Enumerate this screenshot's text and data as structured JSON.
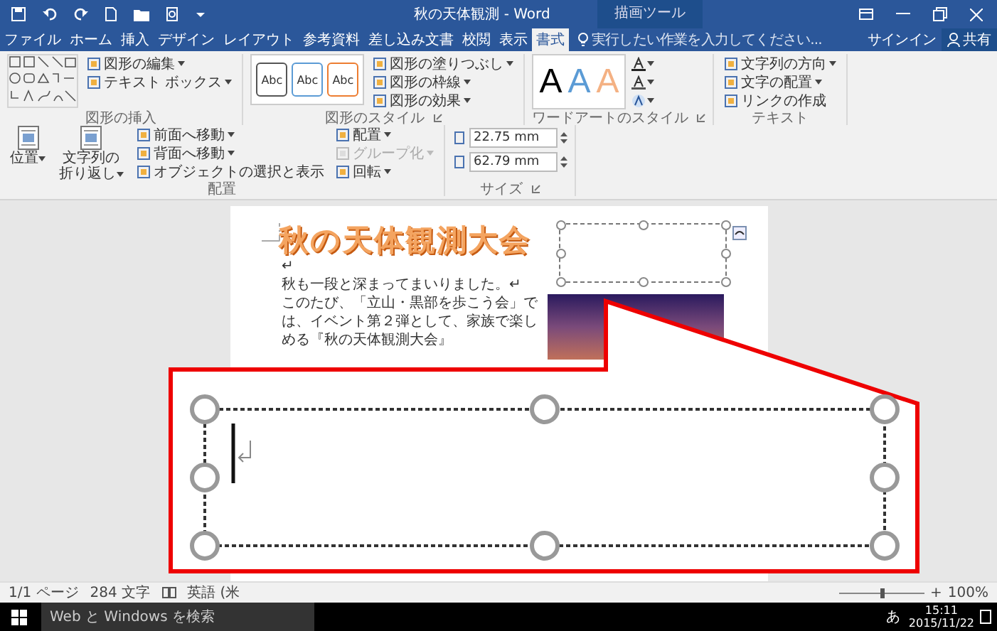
{
  "title_bar": {
    "title": "秋の天体観測 - Word",
    "context_tab": "描画ツール"
  },
  "tabs": [
    {
      "label": "ファイル",
      "selected": false
    },
    {
      "label": "ホーム",
      "selected": false
    },
    {
      "label": "挿入",
      "selected": false
    },
    {
      "label": "デザイン",
      "selected": false
    },
    {
      "label": "レイアウト",
      "selected": false
    },
    {
      "label": "参考資料",
      "selected": false
    },
    {
      "label": "差し込み文書",
      "selected": false
    },
    {
      "label": "校閲",
      "selected": false
    },
    {
      "label": "表示",
      "selected": false
    },
    {
      "label": "書式",
      "selected": true
    }
  ],
  "tell_me": {
    "placeholder": "実行したい作業を入力してください..."
  },
  "account": {
    "sign_in": "サインイン",
    "share": "共有"
  },
  "ribbon": {
    "groups": [
      {
        "label": "図形の挿入",
        "launcher": false,
        "items": [
          {
            "kind": "shapes"
          },
          {
            "kind": "stack",
            "buttons": [
              {
                "label": "図形の編集",
                "dropdown": true,
                "disabled": false
              },
              {
                "label": "テキスト ボックス",
                "dropdown": true,
                "disabled": false
              }
            ]
          }
        ]
      },
      {
        "label": "図形のスタイル",
        "launcher": true,
        "items": [
          {
            "kind": "styles",
            "swatches": [
              {
                "label": "Abc",
                "color": "#555555"
              },
              {
                "label": "Abc",
                "color": "#5b9bd5"
              },
              {
                "label": "Abc",
                "color": "#ed7d31"
              }
            ]
          },
          {
            "kind": "stack",
            "buttons": [
              {
                "label": "図形の塗りつぶし",
                "dropdown": true,
                "disabled": false
              },
              {
                "label": "図形の枠線",
                "dropdown": true,
                "disabled": false
              },
              {
                "label": "図形の効果",
                "dropdown": true,
                "disabled": false
              }
            ]
          }
        ]
      },
      {
        "label": "ワードアートのスタイル",
        "launcher": true,
        "items": [
          {
            "kind": "wordart",
            "letters": [
              {
                "label": "A",
                "color": "#000000"
              },
              {
                "label": "A",
                "color": "#5b9bd5"
              },
              {
                "label": "A",
                "color": "#f4b183"
              }
            ]
          }
        ]
      },
      {
        "label": "テキスト",
        "launcher": false,
        "items": [
          {
            "kind": "stack",
            "buttons": [
              {
                "label": "文字列の方向",
                "dropdown": true,
                "disabled": false
              },
              {
                "label": "文字の配置",
                "dropdown": true,
                "disabled": false
              },
              {
                "label": "リンクの作成",
                "dropdown": false,
                "disabled": false
              }
            ]
          }
        ]
      },
      {
        "label": "配置",
        "launcher": false,
        "items": [
          {
            "kind": "large",
            "label": "位置",
            "dropdown": true
          },
          {
            "kind": "large",
            "label": "文字列の折り返し",
            "dropdown": true
          },
          {
            "kind": "stack",
            "buttons": [
              {
                "label": "前面へ移動",
                "dropdown": true,
                "disabled": false
              },
              {
                "label": "背面へ移動",
                "dropdown": true,
                "disabled": false
              },
              {
                "label": "オブジェクトの選択と表示",
                "dropdown": false,
                "disabled": false
              }
            ]
          },
          {
            "kind": "stack",
            "buttons": [
              {
                "label": "配置",
                "dropdown": true,
                "disabled": false
              },
              {
                "label": "グループ化",
                "dropdown": true,
                "disabled": true
              },
              {
                "label": "回転",
                "dropdown": true,
                "disabled": false
              }
            ]
          }
        ]
      },
      {
        "label": "サイズ",
        "launcher": true,
        "items": [
          {
            "kind": "size",
            "fields": [
              {
                "value": "22.75 mm"
              },
              {
                "value": "62.79 mm"
              }
            ]
          }
        ]
      }
    ]
  },
  "document": {
    "heading": "秋の天体観測大会",
    "paragraphs": [
      "↵",
      "秋も一段と深まってまいりました。↵",
      "このたび、「立山・黒部を歩こう会」では、イベント第２弾として、家族で楽しめる『秋の天体観測大会』"
    ]
  },
  "status_bar": {
    "items": [
      "1/1 ページ",
      "284 文字",
      "英語 (米"
    ],
    "zoom": {
      "plus": "+",
      "level": 0.5,
      "percent": "100%"
    }
  },
  "taskbar": {
    "search": {
      "placeholder": "Web と Windows を検索"
    },
    "ime": "あ",
    "time": "15:11",
    "date": "2015/11/22"
  }
}
